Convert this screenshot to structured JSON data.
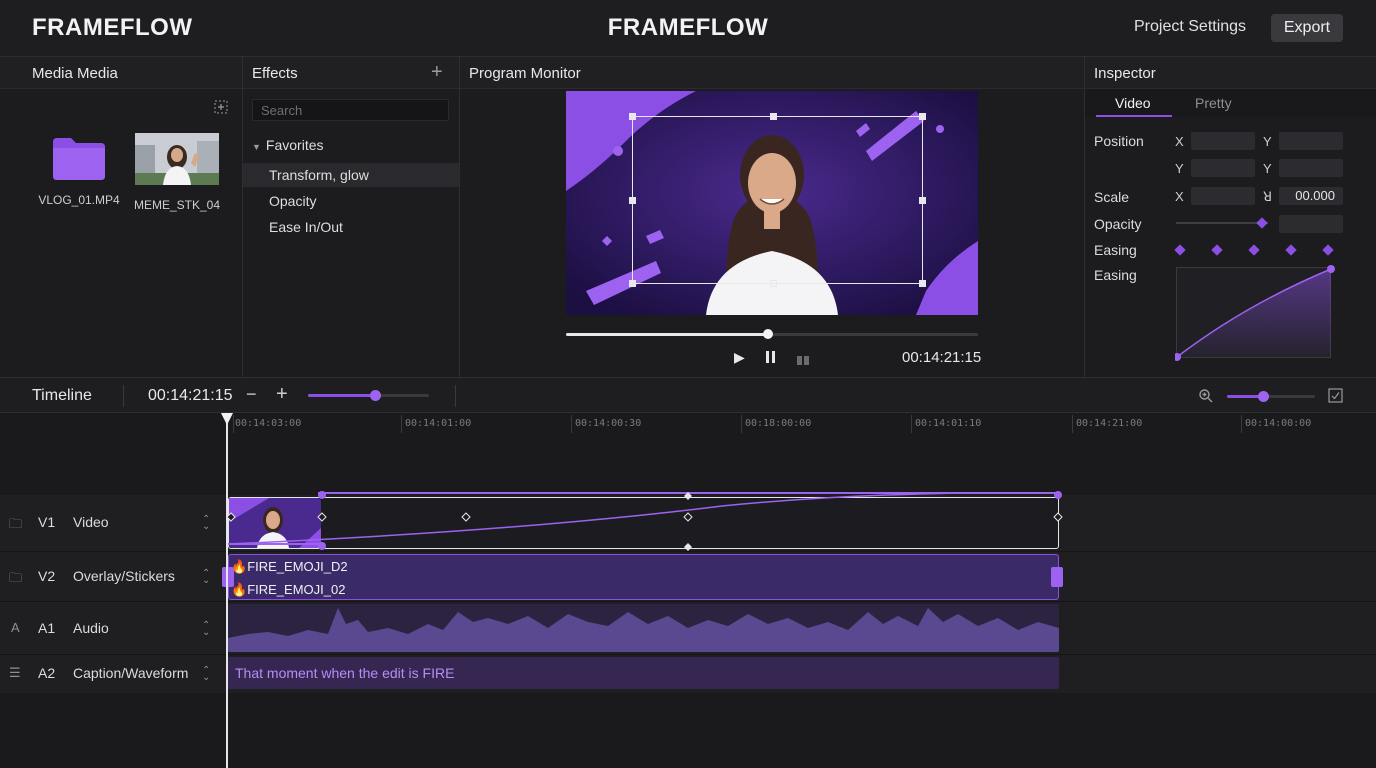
{
  "app": {
    "brand_left": "FRAMEFLOW",
    "brand_center": "FRAMEFLOW",
    "project_settings": "Project Settings",
    "export": "Export"
  },
  "media": {
    "title": "Media Media",
    "items": [
      {
        "label": "VLOG_01.MP4",
        "icon": "folder-icon"
      },
      {
        "label": "MEME_STK_04",
        "icon": "video-thumbnail"
      }
    ]
  },
  "effects": {
    "title": "Effects",
    "search_placeholder": "Search",
    "group": "Favorites",
    "items": [
      "Transform, glow",
      "Opacity",
      "Ease In/Out"
    ]
  },
  "monitor": {
    "title": "Program Monitor",
    "timecode": "00:14:21:15",
    "playhead_progress": 0.49
  },
  "inspector": {
    "title": "Inspector",
    "tabs": [
      "Video",
      "Pretty"
    ],
    "position_label": "Position",
    "scale_label": "Scale",
    "opacity_label": "Opacity",
    "easing_label": "Easing",
    "easing_curve_label": "Easing",
    "axis_x": "X",
    "axis_y": "Y",
    "scale_value": "00.000",
    "scale_axis": "ꓤ",
    "opacity_level": 0.96
  },
  "timeline": {
    "title": "Timeline",
    "timecode": "00:14:21:15",
    "minus": "−",
    "plus": "+",
    "zoom_level": 0.55,
    "ruler": [
      "00:14:03:00",
      "00:14:01:00",
      "00:14:00:30",
      "00:18:00:00",
      "00:14:01:10",
      "00:14:21:00",
      "00:14:00:00"
    ],
    "tracks": [
      {
        "id": "V1",
        "name": "Video"
      },
      {
        "id": "V2",
        "name": "Overlay/Stickers"
      },
      {
        "id": "A1",
        "name": "Audio"
      },
      {
        "id": "A2",
        "name": "Caption/Waveform"
      }
    ],
    "sticker_clips": [
      "FIRE_EMOJI_D2",
      "FIRE_EMOJI_02"
    ],
    "caption": "That moment when the edit is FIRE"
  },
  "colors": {
    "accent": "#8b4fe6",
    "background": "#1a1a1c",
    "panel": "#1c1c1e"
  }
}
